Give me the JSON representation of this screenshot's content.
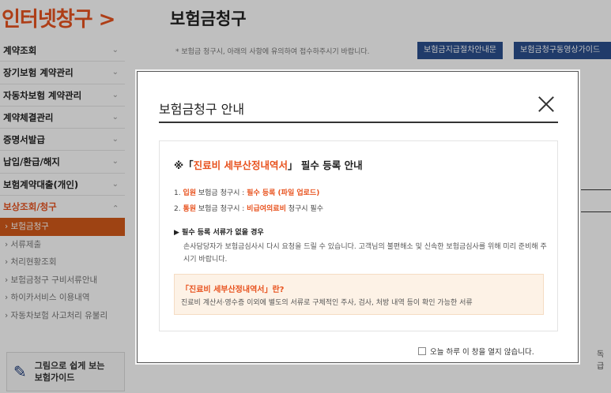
{
  "sidebar": {
    "brand": "인터넷창구 >",
    "menu": [
      {
        "label": "계약조회"
      },
      {
        "label": "장기보험 계약관리"
      },
      {
        "label": "자동차보험 계약관리"
      },
      {
        "label": "계약체결관리"
      },
      {
        "label": "증명서발급"
      },
      {
        "label": "납입/환급/해지"
      },
      {
        "label": "보험계약대출(개인)"
      },
      {
        "label": "보상조회/청구"
      }
    ],
    "chevron": "⌄",
    "submenu": [
      {
        "label": "› 보험금청구"
      },
      {
        "label": "› 서류제출"
      },
      {
        "label": "› 처리현황조회"
      },
      {
        "label": "› 보험금청구 구비서류안내"
      },
      {
        "label": "› 하이카서비스 이용내역"
      },
      {
        "label": "› 자동차보험 사고처리 유불리"
      }
    ],
    "guide": {
      "line1": "그림으로 쉽게 보는",
      "line2": "보험가이드"
    }
  },
  "page": {
    "title": "보험금청구",
    "notice": "* 보험금 청구시, 아래의 사항에 유의하여 접수하주시기 바랍니다.",
    "btn_guide": "보험금지급절차안내문",
    "btn_video": "보험금청구동영상가이드",
    "side_text": "독급"
  },
  "modal": {
    "title": "보험금청구 안내",
    "heading_prefix": "※「",
    "heading_highlight": "진료비 세부산정내역서",
    "heading_suffix": "」 필수 등록 안내",
    "line1": {
      "num": "1. ",
      "type": "입원",
      "mid": " 보험금 청구시 : ",
      "req": "필수 등록 (파일 업로드)"
    },
    "line2": {
      "num": "2. ",
      "type": "통원",
      "mid": " 보험금 청구시 : ",
      "req": "비급여의료비",
      "end": " 청구시 필수"
    },
    "req_title": "▶ 필수 등록 서류가 없을 경우",
    "req_body": "손사담당자가 보험금심사시 다시 요청을 드릴 수 있습니다. 고객님의 불편해소 및 신속한 보험금심사를 위해 미리 준비해 주시기 바랍니다.",
    "callout_title": "「진료비 세부산정내역서」란?",
    "callout_body": "진료비 계산서·영수증 이외에 별도의 서류로 구체적인 주사, 검사, 처방 내역 등이 확인 가능한 서류",
    "optout_label": "오늘 하루 이 창을 열지 않습니다."
  },
  "colors": {
    "brand": "#e8531f",
    "button": "#2b4f8e",
    "active_menu": "#d35a1a"
  }
}
